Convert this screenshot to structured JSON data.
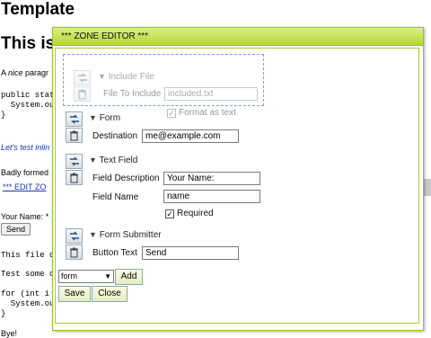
{
  "page": {
    "heading": "Template",
    "heading2": "This is",
    "para_prefix": "A ",
    "para_em": "nice",
    "para_rest": " paragr",
    "code1_line1": "public stat",
    "code1_line2": "  System.ou",
    "code1_line3": "}",
    "inline_italic": "Let's test inlin",
    "badly": "Badly formed",
    "edit_link": "*** EDIT ZO",
    "your_name": "Your Name: *",
    "send_button": "Send",
    "this_file": "This file c",
    "test_some": "Test some c",
    "for_line1": "for (int i",
    "for_line2": "  System.ou",
    "for_line3": "}",
    "bye": "Bye!"
  },
  "dialog": {
    "title": "*** ZONE EDITOR ***",
    "include_file": {
      "title": "Include File",
      "label": "File To Include",
      "value": "included.txt",
      "format_label": "Format as text",
      "format_checked": true
    },
    "form": {
      "title": "Form",
      "destination_label": "Destination",
      "destination_value": "me@example.com"
    },
    "text_field": {
      "title": "Text Field",
      "description_label": "Field Description",
      "description_value": "Your Name:",
      "name_label": "Field Name",
      "name_value": "name",
      "required_label": "Required",
      "required_checked": true
    },
    "form_submitter": {
      "title": "Form Submitter",
      "button_text_label": "Button Text",
      "button_text_value": "Send"
    },
    "add_select": {
      "selected": "form"
    },
    "add_button": "Add",
    "save_button": "Save",
    "close_button": "Close"
  }
}
